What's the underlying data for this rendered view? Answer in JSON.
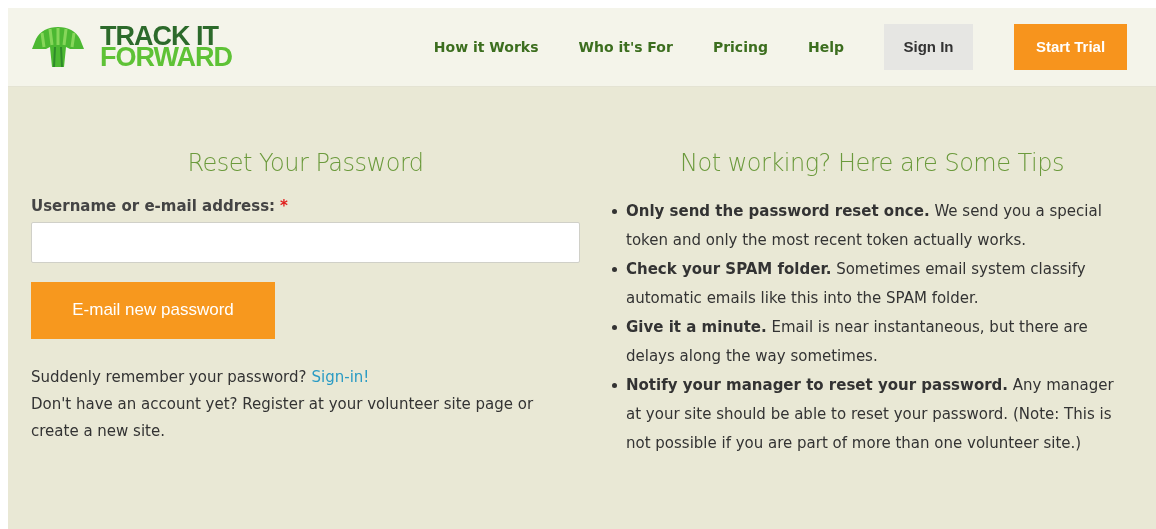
{
  "logo": {
    "line_1": "TRACK IT",
    "line_2": "FORWARD"
  },
  "nav": [
    {
      "label": "How it Works",
      "kind": "link"
    },
    {
      "label": "Who it's For",
      "kind": "link"
    },
    {
      "label": "Pricing",
      "kind": "link"
    },
    {
      "label": "Help",
      "kind": "link"
    },
    {
      "label": "Sign In",
      "kind": "secondary"
    },
    {
      "label": "Start Trial",
      "kind": "primary"
    }
  ],
  "reset": {
    "title": "Reset Your Password",
    "field_label": "Username or e-mail address:",
    "required_mark": "*",
    "button": "E-mail new password",
    "remember_text": "Suddenly remember your password?",
    "remember_link": "Sign-in!",
    "register_text": "Don't have an account yet? Register at your volunteer site page or create a new site."
  },
  "tips": {
    "title": "Not working? Here are Some Tips",
    "items": [
      "**Only send the password reset once.** We send you a special token and only the most recent token actually works.",
      "**Check your SPAM folder.** Sometimes email system classify automatic emails like this into the SPAM folder.",
      "**Give it a minute.** Email is near instantaneous, but there are delays along the way sometimes.",
      "**Notify your manager to reset your password.** Any manager at your site should be able to reset your password. (Note: This is not possible if you are part of more than one volunteer site.)"
    ]
  }
}
